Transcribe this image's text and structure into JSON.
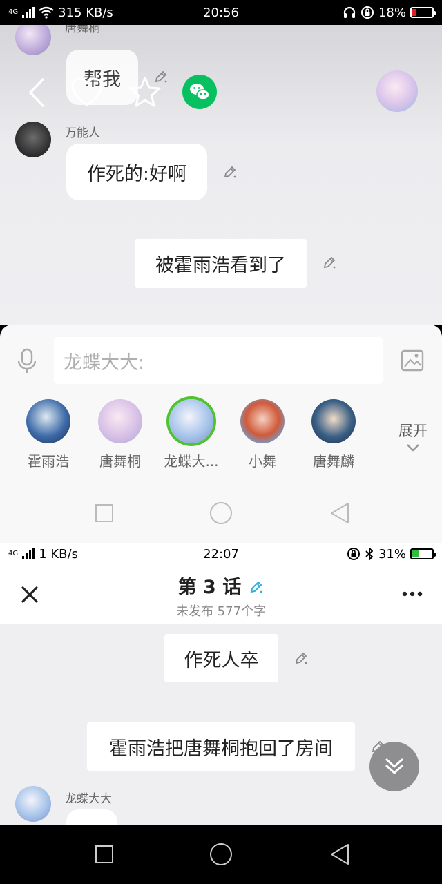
{
  "status_top": {
    "network": "4G",
    "speed": "315 KB/s",
    "time": "20:56",
    "battery": "18%",
    "battery_fraction": 0.18,
    "battery_color": "#e02020"
  },
  "chat_top": {
    "partial_sender": "唐舞桐",
    "partial_message": "帮我",
    "messages": [
      {
        "sender": "万能人",
        "text": "作死的:好啊"
      },
      {
        "text": "被霍雨浩看到了"
      }
    ]
  },
  "composer": {
    "placeholder": "龙蝶大大:",
    "expand_label": "展开",
    "characters": [
      {
        "name": "霍雨浩"
      },
      {
        "name": "唐舞桐"
      },
      {
        "name": "龙蝶大..."
      },
      {
        "name": "小舞"
      },
      {
        "name": "唐舞麟"
      }
    ],
    "selected_index": 2
  },
  "status_bottom": {
    "network": "4G",
    "speed": "1 KB/s",
    "time": "22:07",
    "battery": "31%",
    "battery_fraction": 0.31,
    "battery_color": "#2fbf3a"
  },
  "chapter": {
    "title": "第 3 话",
    "subtitle": "未发布 577个字"
  },
  "chat_bottom": {
    "messages": [
      {
        "text": "作死人卒"
      },
      {
        "text": "霍雨浩把唐舞桐抱回了房间"
      }
    ],
    "next_sender": "龙蝶大大"
  },
  "colors": {
    "accent_green": "#4ec22f",
    "wechat_green": "#07c160",
    "edit_cyan": "#2ab0e0"
  },
  "icons": {
    "back": "chevron-left-icon",
    "like": "heart-icon",
    "favorite": "star-icon",
    "share": "wechat-icon",
    "edit": "pencil-icon",
    "voice": "microphone-icon",
    "image": "image-icon",
    "more": "more-icon",
    "close": "close-icon",
    "scroll": "double-chevron-down-icon"
  }
}
